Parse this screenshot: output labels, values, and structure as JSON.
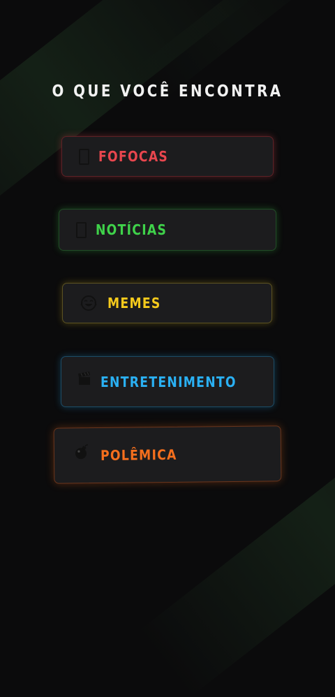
{
  "heading": {
    "title": "O QUE VOCÊ ENCONTRA"
  },
  "categories": [
    {
      "id": "fofocas",
      "label": "FOFOCAS",
      "icon": "missing-glyph-icon",
      "color": "#e8464e"
    },
    {
      "id": "noticias",
      "label": "NOTÍCIAS",
      "icon": "missing-glyph-icon",
      "color": "#3fd24a"
    },
    {
      "id": "memes",
      "label": "MEMES",
      "icon": "laughing-face-icon",
      "color": "#f4c91c"
    },
    {
      "id": "entretenimento",
      "label": "ENTRETENIMENTO",
      "icon": "clapperboard-icon",
      "color": "#2ab0f3"
    },
    {
      "id": "polemica",
      "label": "POLÊMICA",
      "icon": "bomb-icon",
      "color": "#f56f1d"
    }
  ]
}
